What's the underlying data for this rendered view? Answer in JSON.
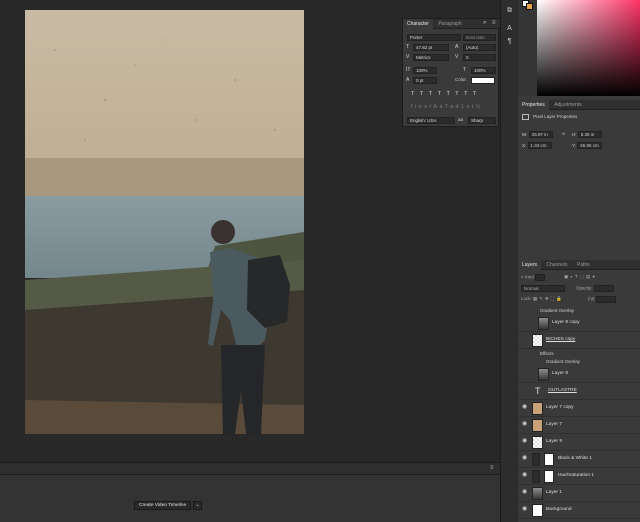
{
  "character_panel": {
    "tabs": [
      "Character",
      "Paragraph"
    ],
    "font_family": "Porter",
    "font_style": "Bold Italic",
    "font_size": "47.82 pt",
    "leading": "(Auto)",
    "kerning": "Metrics",
    "tracking": "0",
    "vertical_scale": "100%",
    "horizontal_scale": "100%",
    "baseline_shift": "0 pt",
    "color_label": "Color:",
    "type_style_glyphs": "TTTTTTTT",
    "opentype_glyphs": "fiσstAaTad1st½",
    "language": "English: USA",
    "antialias": "Sharp"
  },
  "properties_panel": {
    "tabs": [
      "Properties",
      "Adjustments"
    ],
    "title": "Pixel Layer Properties",
    "w_label": "W:",
    "w_value": "25.97 in",
    "h_label": "H:",
    "h_value": "5.36 in",
    "x_label": "X:",
    "x_value": "1.34 cm",
    "y_label": "Y:",
    "y_value": "66.96 cm"
  },
  "layers_panel": {
    "tabs": [
      "Layers",
      "Channels",
      "Paths"
    ],
    "filter_kind": "Kind",
    "blend_mode": "Normal",
    "opacity_label": "Opacity:",
    "lock_label": "Lock:",
    "fill_label": "Fill:",
    "rows": [
      {
        "type": "sub",
        "label": "Gradient Overlay"
      },
      {
        "type": "layer",
        "name": "Layer 8 copy",
        "thumb": "photo",
        "visible": false
      },
      {
        "type": "layer",
        "name": "BICHES copy",
        "thumb": "checker",
        "visible": false
      },
      {
        "type": "sub",
        "label": "Effects"
      },
      {
        "type": "sub",
        "label": "Gradient Overlay"
      },
      {
        "type": "layer",
        "name": "Layer 8",
        "thumb": "photo",
        "visible": false
      },
      {
        "type": "text",
        "name": "OUTLASTRE",
        "visible": false
      },
      {
        "type": "layer",
        "name": "Layer 7 copy",
        "thumb": "tan",
        "visible": true
      },
      {
        "type": "layer",
        "name": "Layer 7",
        "thumb": "tan",
        "visible": true
      },
      {
        "type": "layer",
        "name": "Layer 9",
        "thumb": "checker",
        "visible": true
      },
      {
        "type": "adj",
        "name": "Black & White 1",
        "visible": true
      },
      {
        "type": "adj",
        "name": "Hue/Saturation 1",
        "visible": true
      },
      {
        "type": "layer",
        "name": "Layer 1",
        "thumb": "photo",
        "visible": true
      },
      {
        "type": "layer",
        "name": "Background",
        "thumb": "white",
        "visible": true
      }
    ]
  },
  "timeline": {
    "create_button": "Create Video Timeline"
  },
  "colors": {
    "foreground": "#ffffff",
    "background": "#e5a24a"
  }
}
